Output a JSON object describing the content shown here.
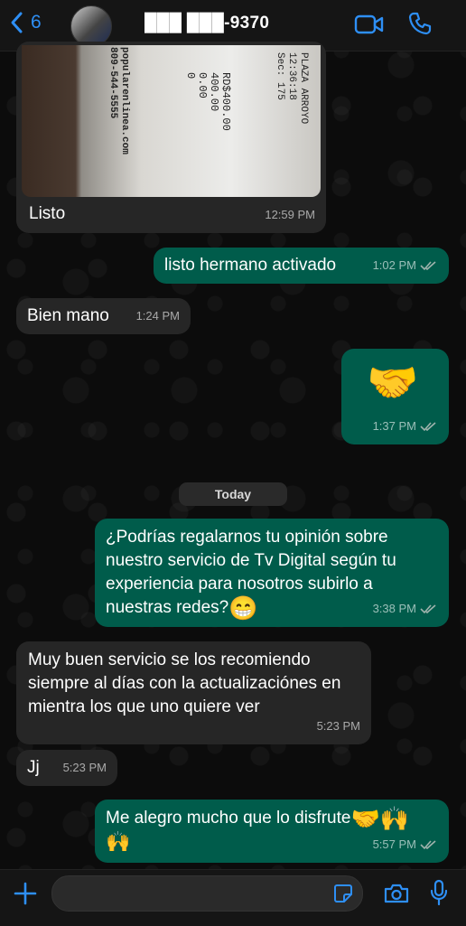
{
  "header": {
    "back_count": "6",
    "contact_name": "███ ███-9370"
  },
  "photo_message": {
    "receipt_text_1": "PLAZA ARROYO\n12:36:18\nSec: 175",
    "receipt_text_2": "RD$400.00\n400.00\n0.00\n0",
    "receipt_text_3": "popularenlinea.com\n809-544-5555",
    "caption": "Listo",
    "time": "12:59 PM"
  },
  "messages": [
    {
      "dir": "out",
      "text": "listo hermano activado",
      "time": "1:02 PM"
    },
    {
      "dir": "in",
      "text": "Bien mano",
      "time": "1:24 PM"
    },
    {
      "dir": "out",
      "emoji": "🤝",
      "time": "1:37 PM"
    },
    {
      "dir": "out",
      "text": "¿Podrías regalarnos tu opinión sobre nuestro servicio de Tv Digital según tu experiencia para nosotros subirlo a nuestras redes?",
      "emoji": "😁",
      "time": "3:38 PM"
    },
    {
      "dir": "in",
      "text": "Muy buen servicio se los recomiendo siempre al días con la actualizaciónes en mientra los que uno quiere ver",
      "time": "5:23 PM"
    },
    {
      "dir": "in",
      "text": "Jj",
      "time": "5:23 PM"
    },
    {
      "dir": "out",
      "text": "Me alegro mucho que lo disfrute",
      "emoji": "🤝🙌",
      "emoji_line2": "🙌",
      "time": "5:57 PM"
    }
  ],
  "date_separator": "Today",
  "colors": {
    "incoming_bubble": "#262626",
    "outgoing_bubble": "#005c4b",
    "accent": "#2e8ff5",
    "background": "#0b0b0b"
  },
  "icons": {
    "back": "chevron-left-icon",
    "video": "video-camera-icon",
    "call": "phone-icon",
    "add": "plus-icon",
    "sticker": "sticker-icon",
    "camera": "camera-icon",
    "mic": "microphone-icon",
    "read": "double-check-icon"
  }
}
